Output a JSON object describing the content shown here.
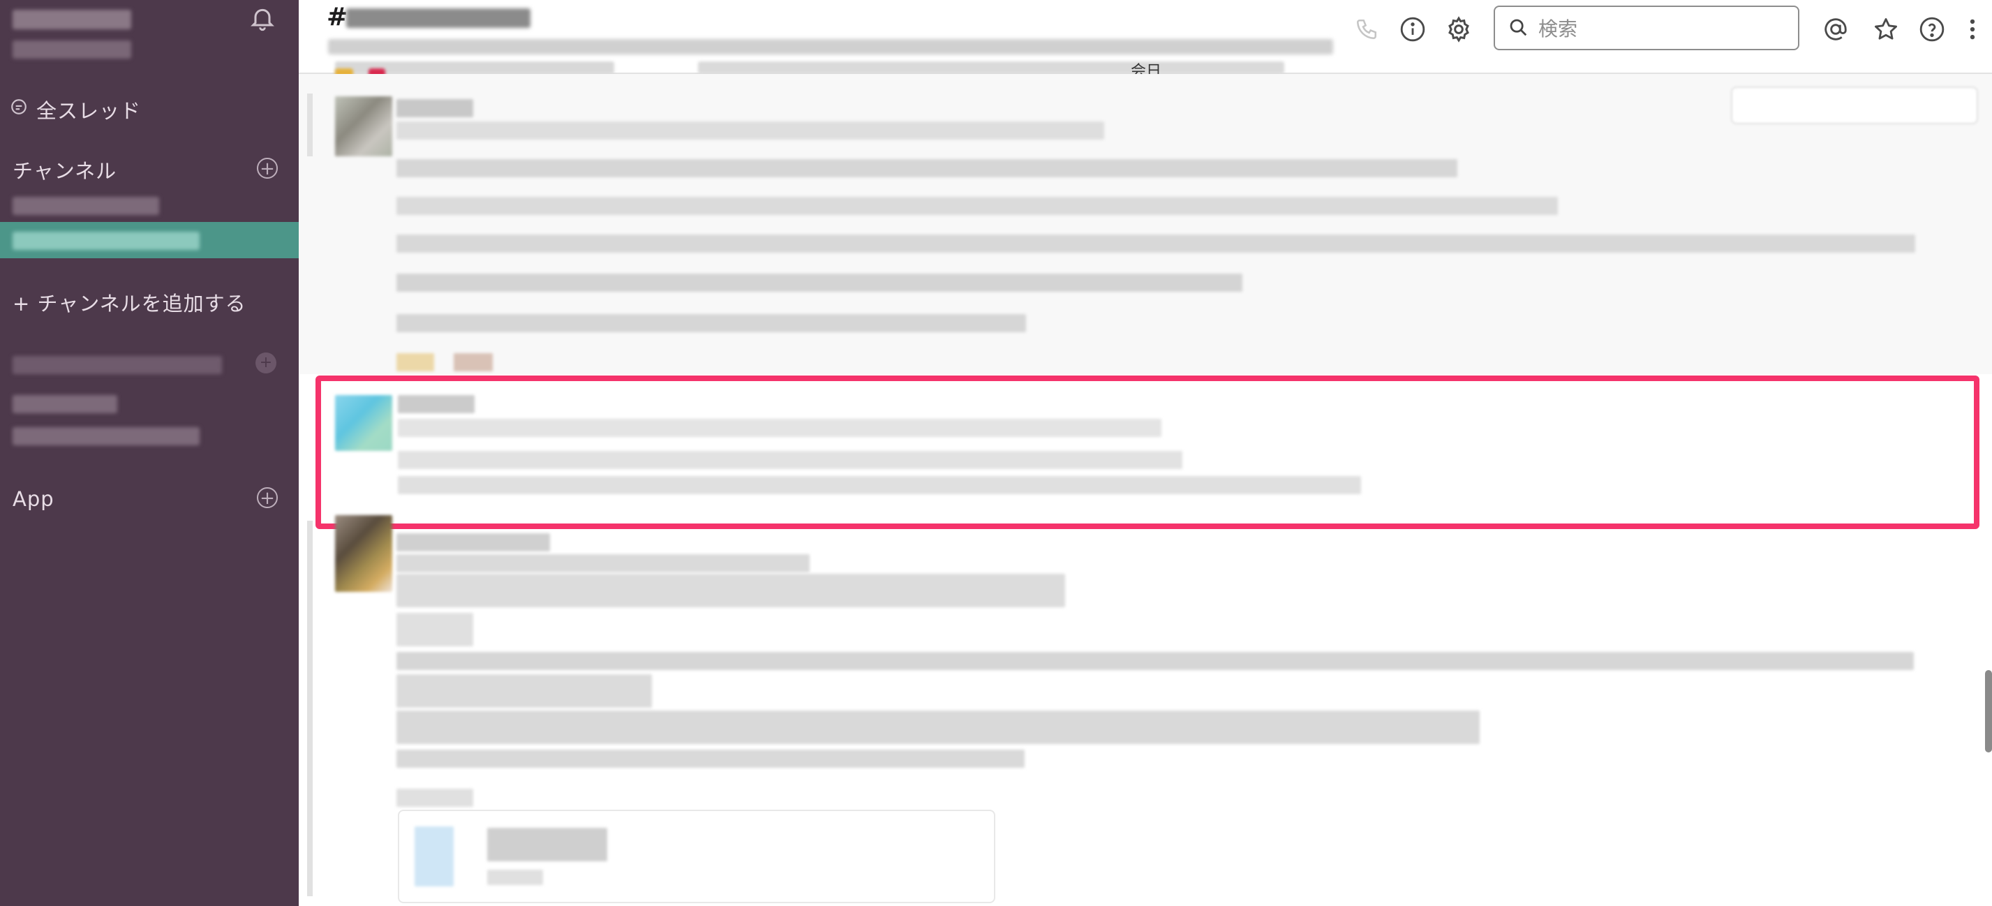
{
  "sidebar": {
    "all_threads_label": "全スレッド",
    "channels_header": "チャンネル",
    "add_channel_label": "+ チャンネルを追加する",
    "direct_messages_header": "ダイレクトメッセージ",
    "apps_header": "App",
    "active_color": "#4c9689",
    "background_color": "#4d394b"
  },
  "header": {
    "hash_prefix": "#",
    "topic_fragment": "会日"
  },
  "search": {
    "placeholder": "検索"
  },
  "icons": {
    "notifications": "bell-icon",
    "call": "phone-icon",
    "details": "info-icon",
    "settings": "gear-icon",
    "search": "search-icon",
    "mentions": "at-sign-icon",
    "saved": "star-icon",
    "help": "help-icon",
    "more": "more-vertical-icon"
  },
  "highlight_color": "#f5336b"
}
